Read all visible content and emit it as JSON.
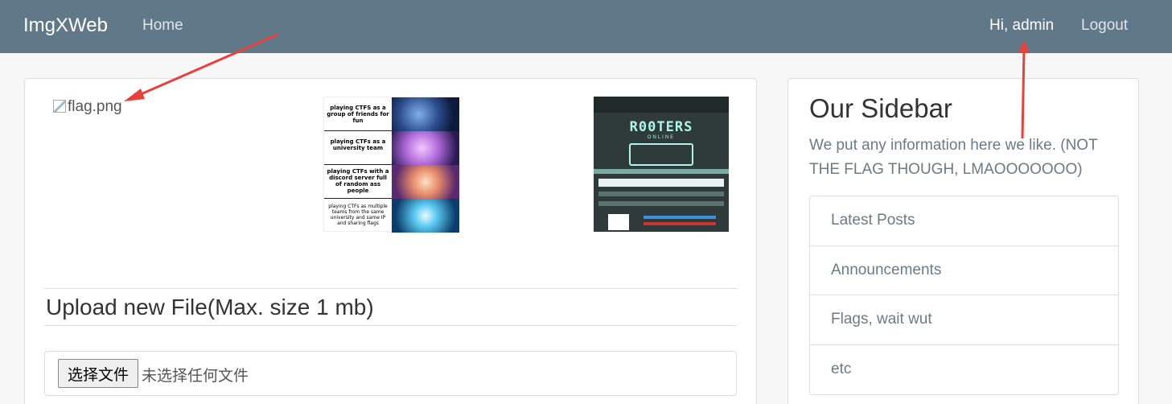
{
  "navbar": {
    "brand": "ImgXWeb",
    "home_label": "Home",
    "greeting": "Hi, admin",
    "logout_label": "Logout",
    "bg_color": "#617889"
  },
  "gallery": {
    "broken_image_alt": "flag.png",
    "meme": {
      "panels": [
        "playing CTFS as a group of friends for fun",
        "playing CTFs as a university team",
        "playing CTFs with a discord server full of random ass people",
        "playing CTFs as multiple teams from the same university and same IP and sharing flags"
      ]
    },
    "poster": {
      "title": "R00TERS",
      "subtitle": "ONLINE"
    }
  },
  "upload": {
    "title": "Upload new File(Max. size 1 mb)",
    "choose_button": "选择文件",
    "no_file_text": "未选择任何文件"
  },
  "sidebar": {
    "title": "Our Sidebar",
    "description": "We put any information here we like. (NOT THE FLAG THOUGH, LMAOOOOOOO)",
    "items": [
      {
        "label": "Latest Posts"
      },
      {
        "label": "Announcements"
      },
      {
        "label": "Flags, wait wut"
      },
      {
        "label": "etc"
      }
    ]
  },
  "annotation_color": "#e8413b"
}
